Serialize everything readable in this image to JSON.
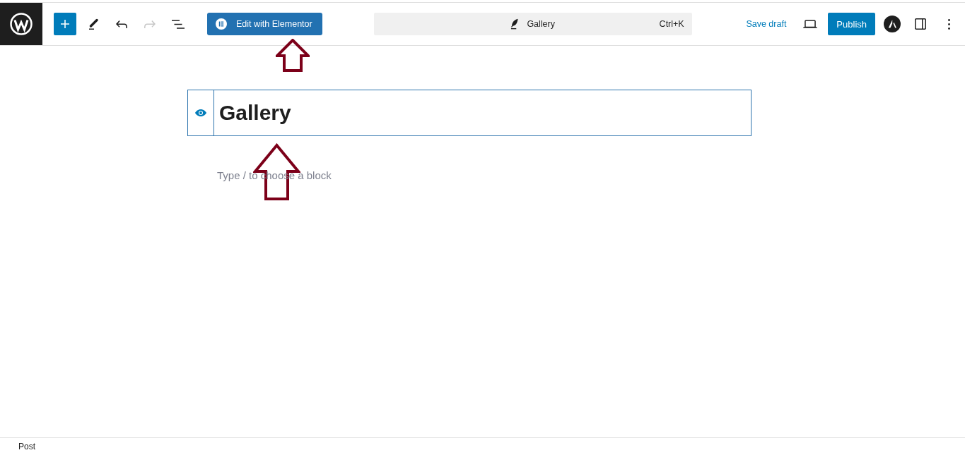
{
  "toolbar": {
    "tools": [
      {
        "kind": "add",
        "disabled": false
      },
      {
        "kind": "edit",
        "disabled": false
      },
      {
        "kind": "undo",
        "disabled": false
      },
      {
        "kind": "redo",
        "disabled": true
      },
      {
        "kind": "list_view",
        "disabled": false
      }
    ],
    "elementor_button": "Edit with Elementor",
    "command_bar": {
      "title": "Gallery",
      "shortcut": "Ctrl+K"
    },
    "save_draft": "Save draft",
    "publish": "Publish"
  },
  "editor": {
    "title": "Gallery",
    "placeholder": "Type / to choose a block"
  },
  "footer": {
    "breadcrumb": "Post"
  }
}
